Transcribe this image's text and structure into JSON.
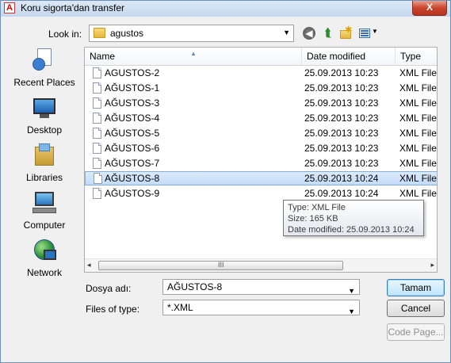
{
  "window": {
    "title": "Koru sigorta'dan transfer",
    "close_label": "X",
    "app_icon_label": "A"
  },
  "toolbar": {
    "look_in_label": "Look in:",
    "look_in_value": "agustos",
    "icons": [
      "back-icon",
      "up-folder-icon",
      "new-folder-icon",
      "views-menu-icon"
    ]
  },
  "places": [
    {
      "label": "Recent Places",
      "icon": "recent-places-icon"
    },
    {
      "label": "Desktop",
      "icon": "desktop-icon"
    },
    {
      "label": "Libraries",
      "icon": "libraries-icon"
    },
    {
      "label": "Computer",
      "icon": "computer-icon"
    },
    {
      "label": "Network",
      "icon": "network-icon"
    }
  ],
  "columns": {
    "name": "Name",
    "date": "Date modified",
    "type": "Type"
  },
  "files": [
    {
      "name": "AGUSTOS-2",
      "date": "25.09.2013 10:23",
      "type": "XML File"
    },
    {
      "name": "AĞUSTOS-1",
      "date": "25.09.2013 10:23",
      "type": "XML File"
    },
    {
      "name": "AĞUSTOS-3",
      "date": "25.09.2013 10:23",
      "type": "XML File"
    },
    {
      "name": "AĞUSTOS-4",
      "date": "25.09.2013 10:23",
      "type": "XML File"
    },
    {
      "name": "AĞUSTOS-5",
      "date": "25.09.2013 10:23",
      "type": "XML File"
    },
    {
      "name": "AĞUSTOS-6",
      "date": "25.09.2013 10:23",
      "type": "XML File"
    },
    {
      "name": "AĞUSTOS-7",
      "date": "25.09.2013 10:23",
      "type": "XML File"
    },
    {
      "name": "AĞUSTOS-8",
      "date": "25.09.2013 10:24",
      "type": "XML File",
      "selected": true
    },
    {
      "name": "AĞUSTOS-9",
      "date": "25.09.2013 10:24",
      "type": "XML File"
    }
  ],
  "scrollbar": {
    "left_arrow": "◂",
    "right_arrow": "▸",
    "grip": "III"
  },
  "tooltip": {
    "type": "Type: XML File",
    "size": "Size: 165 KB",
    "date": "Date modified: 25.09.2013 10:24"
  },
  "form": {
    "filename_label": "Dosya adı:",
    "filename_value": "AĞUSTOS-8",
    "filetype_label": "Files of type:",
    "filetype_value": "*.XML",
    "open_label": "Tamam",
    "cancel_label": "Cancel",
    "codepage_label": "Code Page..."
  }
}
